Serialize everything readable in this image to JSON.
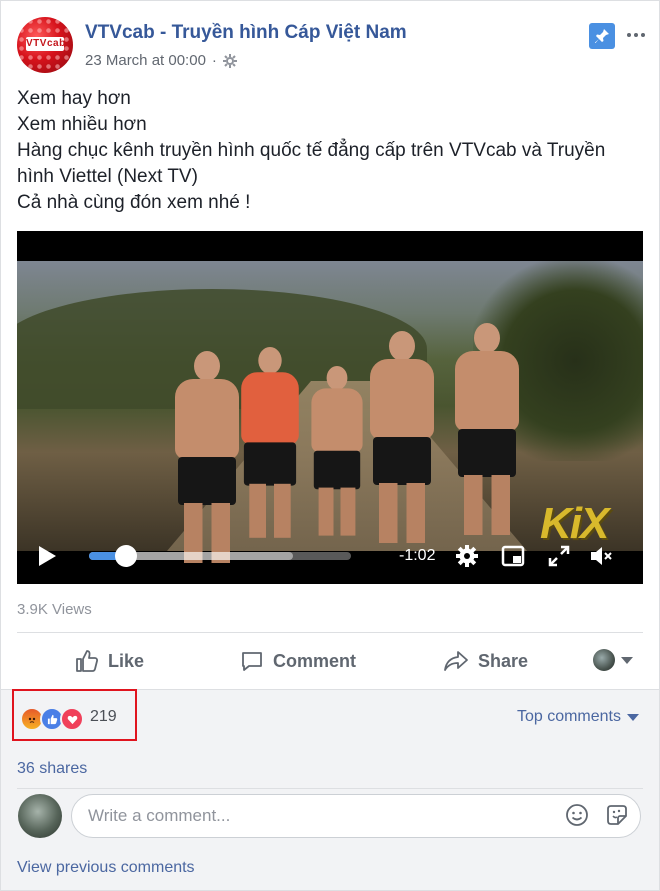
{
  "post": {
    "page_name": "VTVcab - Truyền hình Cáp Việt Nam",
    "avatar_logo": "VTVcab",
    "timestamp": "23 March at 00:00",
    "separator": "·",
    "text_lines": [
      "Xem hay hơn",
      "Xem nhiều hơn",
      "Hàng chục kênh truyền hình quốc tế đẳng cấp trên VTVcab và Truyền hình Viettel (Next TV)",
      "Cả nhà cùng đón xem nhé !"
    ]
  },
  "video": {
    "time_remaining": "-1:02",
    "progress_fraction": 0.14,
    "buffered_fraction": 0.78,
    "watermark": "KiX"
  },
  "stats": {
    "views": "3.9K Views",
    "reaction_count": "219",
    "reactions": [
      "angry",
      "like",
      "love"
    ],
    "shares": "36 shares"
  },
  "actions": {
    "like": "Like",
    "comment": "Comment",
    "share": "Share"
  },
  "comments": {
    "sort_label": "Top comments",
    "input_placeholder": "Write a comment...",
    "view_previous": "View previous comments"
  },
  "colors": {
    "link": "#365899",
    "highlight_box": "#e0141e",
    "progress": "#4a90e2",
    "pin": "#4a90e2"
  },
  "icons": [
    "gear-icon",
    "pin-icon",
    "more-icon",
    "play-icon",
    "settings-icon",
    "pip-icon",
    "fullscreen-icon",
    "mute-icon",
    "like-icon",
    "comment-icon",
    "share-icon",
    "emoji-icon",
    "sticker-icon",
    "chevron-down-icon"
  ]
}
